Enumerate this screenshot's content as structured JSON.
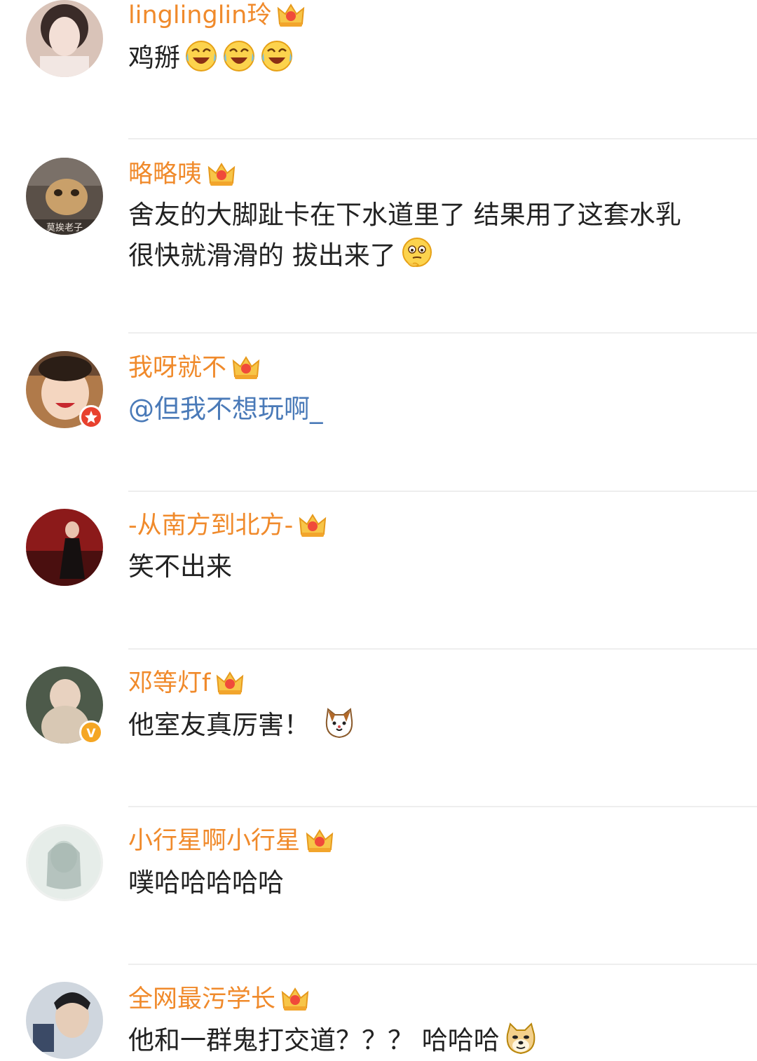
{
  "theme": {
    "username_color": "#f08a2b",
    "text_color": "#222222",
    "mention_color": "#4a7ab8",
    "divider_color": "#eeeeee",
    "vip_badge_color": "#f5a623",
    "weibo_badge_color": "#e8412e"
  },
  "comments": [
    {
      "username": "linglinglin玲",
      "badge_icon": "vip-crown-icon",
      "text": "鸡掰",
      "emojis": [
        "laugh-cry-emoji",
        "laugh-cry-emoji",
        "laugh-cry-emoji"
      ]
    },
    {
      "username": "略略咦",
      "badge_icon": "vip-crown-icon",
      "text_line1": "舍友的大脚趾卡在下水道里了 结果用了这套水乳",
      "text_line2": "很快就滑滑的 拔出来了",
      "emojis": [
        "thinking-emoji"
      ],
      "avatar_caption": "莫挨老子"
    },
    {
      "username": "我呀就不",
      "badge_icon": "vip-crown-icon",
      "text": "@但我不想玩啊_",
      "avatar_badge": "weibo-star-badge"
    },
    {
      "username": "-从南方到北方-",
      "badge_icon": "vip-crown-icon",
      "text": "笑不出来"
    },
    {
      "username": "邓等灯f",
      "badge_icon": "vip-crown-icon",
      "text": "他室友真厉害！",
      "emojis": [
        "cat-emoji"
      ],
      "avatar_badge": "verified-v-badge",
      "avatar_badge_letter": "V"
    },
    {
      "username": "小行星啊小行星",
      "badge_icon": "vip-crown-icon",
      "text": "噗哈哈哈哈哈"
    },
    {
      "username": "全网最污学长",
      "badge_icon": "vip-crown-icon",
      "text": "他和一群鬼打交道？？？ 哈哈哈",
      "emojis": [
        "doge-emoji"
      ]
    }
  ]
}
